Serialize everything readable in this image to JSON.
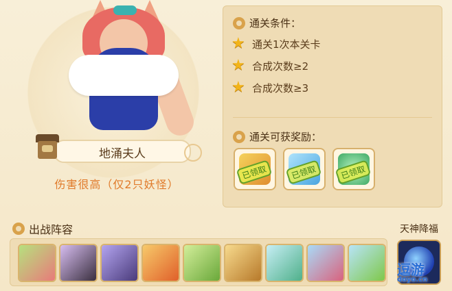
{
  "hero": {
    "name": "地涌夫人",
    "description": "伤害很高（仅2只妖怪）"
  },
  "conditions": {
    "title": "通关条件：",
    "items": [
      {
        "label": "通关1次本关卡",
        "icon": "star-icon"
      },
      {
        "label": "合成次数≥2",
        "icon": "star-icon"
      },
      {
        "label": "合成次数≥3",
        "icon": "star-icon"
      }
    ]
  },
  "rewards": {
    "title": "通关可获奖励：",
    "items": [
      {
        "icon": "exp-reward-icon",
        "stamp": "已领取",
        "color": "#e8c44b"
      },
      {
        "icon": "crystal-heart-reward-icon",
        "stamp": "已领取",
        "color": "#7ec9ee"
      },
      {
        "icon": "jade-orb-reward-icon",
        "stamp": "已领取",
        "color": "#6fcf8e"
      }
    ]
  },
  "lineup": {
    "title": "出战阵容",
    "slots": [
      {
        "icon": "pink-hair-girl-avatar",
        "color": "#9bcf62"
      },
      {
        "icon": "dark-hair-girl-avatar",
        "color": "#c9a4e0"
      },
      {
        "icon": "purple-haired-warrior-avatar",
        "color": "#9f8fe6"
      },
      {
        "icon": "orange-fox-avatar",
        "color": "#f0b54a"
      },
      {
        "icon": "green-frog-avatar",
        "color": "#b6dd79"
      },
      {
        "icon": "golden-lion-avatar",
        "color": "#f0c56a"
      },
      {
        "icon": "green-sword-avatar",
        "color": "#9fdbe6"
      },
      {
        "icon": "hat-pig-avatar",
        "color": "#7fc6f0"
      },
      {
        "icon": "green-bug-avatar",
        "color": "#8ccff0"
      }
    ]
  },
  "blessing": {
    "title": "天神降福",
    "icon": "blue-orb-icon"
  },
  "watermark": {
    "main": "逗游",
    "sub": "doyo.cn"
  }
}
